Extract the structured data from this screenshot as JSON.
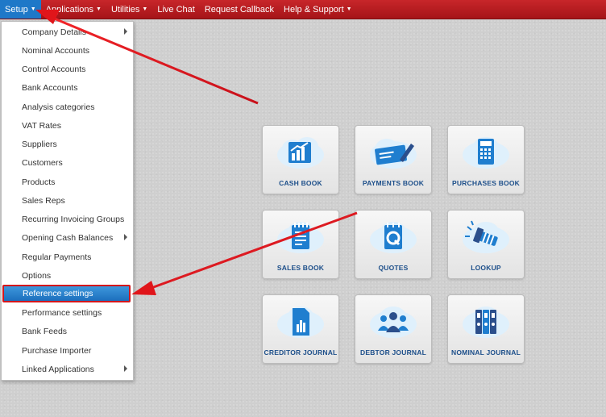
{
  "nav": {
    "items": [
      {
        "label": "Setup",
        "caret": true
      },
      {
        "label": "Applications",
        "caret": true
      },
      {
        "label": "Utilities",
        "caret": true
      },
      {
        "label": "Live Chat",
        "caret": false
      },
      {
        "label": "Request Callback",
        "caret": false
      },
      {
        "label": "Help & Support",
        "caret": true
      }
    ]
  },
  "setup_menu": {
    "items": [
      {
        "label": "Company Details",
        "submenu": true
      },
      {
        "label": "Nominal Accounts",
        "submenu": false
      },
      {
        "label": "Control Accounts",
        "submenu": false
      },
      {
        "label": "Bank Accounts",
        "submenu": false
      },
      {
        "label": "Analysis categories",
        "submenu": false
      },
      {
        "label": "VAT Rates",
        "submenu": false
      },
      {
        "label": "Suppliers",
        "submenu": false
      },
      {
        "label": "Customers",
        "submenu": false
      },
      {
        "label": "Products",
        "submenu": false
      },
      {
        "label": "Sales Reps",
        "submenu": false
      },
      {
        "label": "Recurring Invoicing Groups",
        "submenu": false
      },
      {
        "label": "Opening Cash Balances",
        "submenu": true
      },
      {
        "label": "Regular Payments",
        "submenu": false
      },
      {
        "label": "Options",
        "submenu": false
      },
      {
        "label": "Reference settings",
        "submenu": false
      },
      {
        "label": "Performance settings",
        "submenu": false
      },
      {
        "label": "Bank Feeds",
        "submenu": false
      },
      {
        "label": "Purchase Importer",
        "submenu": false
      },
      {
        "label": "Linked Applications",
        "submenu": true
      }
    ],
    "highlighted": "Reference settings"
  },
  "tiles": [
    {
      "label": "CASH BOOK",
      "icon": "bar-chart-icon"
    },
    {
      "label": "PAYMENTS BOOK",
      "icon": "cheque-pen-icon"
    },
    {
      "label": "PURCHASES BOOK",
      "icon": "calculator-icon"
    },
    {
      "label": "SALES BOOK",
      "icon": "notepad-icon"
    },
    {
      "label": "QUOTES",
      "icon": "quote-document-icon"
    },
    {
      "label": "LOOKUP",
      "icon": "flashlight-icon"
    },
    {
      "label": "CREDITOR JOURNAL",
      "icon": "document-chart-icon"
    },
    {
      "label": "DEBTOR JOURNAL",
      "icon": "people-icon"
    },
    {
      "label": "NOMINAL JOURNAL",
      "icon": "binders-icon"
    }
  ],
  "colors": {
    "navbar": "#b71c1f",
    "active_nav": "#1e78c8",
    "highlight": "#1c6fbd",
    "annotation_arrow": "#e0151a",
    "tile_label": "#1d4f8a"
  }
}
